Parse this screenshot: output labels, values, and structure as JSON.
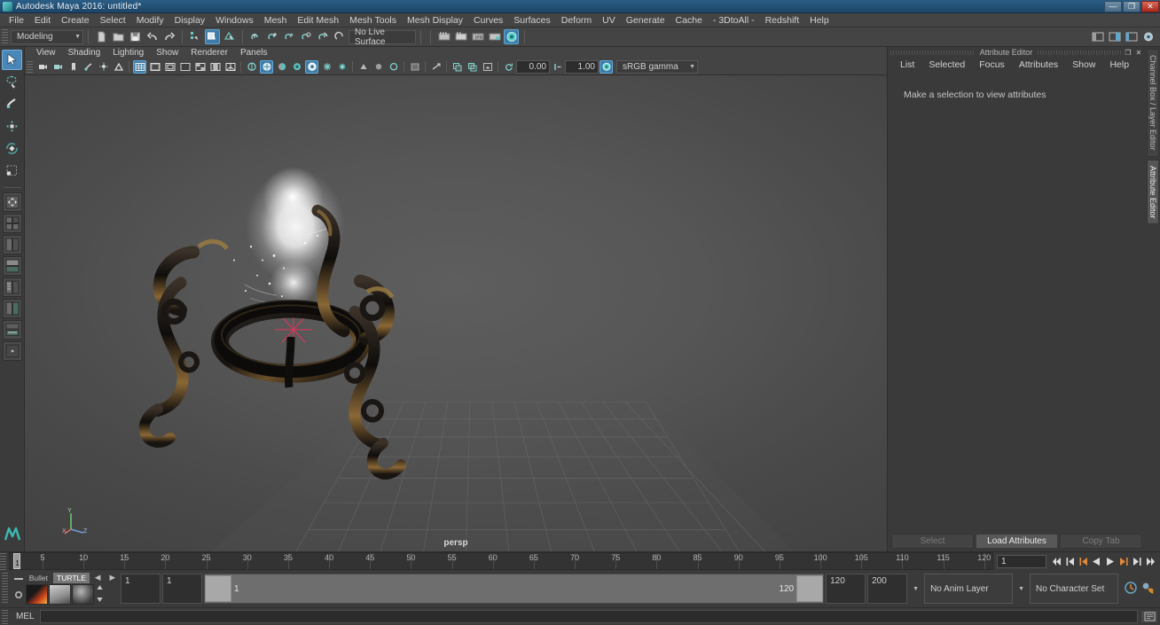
{
  "window": {
    "title": "Autodesk Maya 2016: untitled*",
    "app_icon": "maya-logo-icon",
    "buttons": [
      {
        "name": "minimize-button",
        "glyph": "—"
      },
      {
        "name": "restore-button",
        "glyph": "❐"
      },
      {
        "name": "close-button",
        "glyph": "✕"
      }
    ]
  },
  "menubar": {
    "items": [
      "File",
      "Edit",
      "Create",
      "Select",
      "Modify",
      "Display",
      "Windows",
      "Mesh",
      "Edit Mesh",
      "Mesh Tools",
      "Mesh Display",
      "Curves",
      "Surfaces",
      "Deform",
      "UV",
      "Generate",
      "Cache",
      "- 3DtoAll -",
      "Redshift",
      "Help"
    ]
  },
  "statusbar": {
    "menuset": "Modeling",
    "menuset_arrow": "▼",
    "file_icons": [
      "new-scene-icon",
      "open-scene-icon",
      "save-scene-icon",
      "undo-icon",
      "redo-icon"
    ],
    "select_mode_icons": [
      "select-by-hierarchy-icon",
      "select-by-object-icon",
      "select-by-component-icon"
    ],
    "snap_icons": [
      "snap-to-grid-icon",
      "snap-to-curve-icon",
      "snap-to-point-icon",
      "snap-to-projected-center-icon",
      "snap-to-view-plane-icon",
      "make-live-icon"
    ],
    "live_surface": "No Live Surface",
    "render_icons": [
      "render-current-frame-icon",
      "ipr-render-icon",
      "render-settings-icon",
      "hypershade-icon",
      "render-view-icon"
    ],
    "right_icons": [
      "show-hide-modeling-toolkit-icon",
      "show-hide-attribute-editor-icon",
      "show-hide-tool-settings-icon",
      "show-hide-channel-box-icon"
    ]
  },
  "toolbox": {
    "tools": [
      {
        "name": "select-tool",
        "icon": "arrow-cursor-icon",
        "active": true
      },
      {
        "name": "lasso-select-tool",
        "icon": "lasso-icon",
        "active": false
      },
      {
        "name": "paint-select-tool",
        "icon": "paintbrush-icon",
        "active": false
      },
      {
        "name": "move-tool",
        "icon": "move-arrows-icon",
        "active": false
      },
      {
        "name": "rotate-tool",
        "icon": "rotate-ring-icon",
        "active": false
      },
      {
        "name": "scale-tool",
        "icon": "scale-box-icon",
        "active": false
      }
    ],
    "layouts": [
      "layout-single-perspective",
      "layout-four-view",
      "layout-two-panes-side",
      "layout-two-panes-stacked",
      "layout-three-panes",
      "layout-persp-outliner",
      "layout-persp-graph",
      "layout-custom"
    ]
  },
  "viewport": {
    "panel_menu": [
      "View",
      "Shading",
      "Lighting",
      "Show",
      "Renderer",
      "Panels"
    ],
    "toolbar_icons": [
      "select-camera-icon",
      "camera-attributes-icon",
      "bookmark-icon",
      "image-plane-icon",
      "two-sided-lighting-icon",
      "grid-toggle-icon",
      "film-gate-icon",
      "resolution-gate-icon",
      "gate-mask-icon",
      "field-chart-icon",
      "safe-action-icon",
      "safe-title-icon",
      "wireframe-icon",
      "smooth-shade-all-icon",
      "shaded-wireframe-icon",
      "textured-icon",
      "use-all-lights-icon",
      "shadows-icon",
      "ao-icon",
      "motion-blur-icon",
      "multisample-icon",
      "depth-of-field-icon",
      "xray-mode-icon",
      "xray-joints-icon"
    ],
    "exposure_value": "0.00",
    "gamma_value": "1.00",
    "color_management": "sRGB gamma",
    "color_management_arrow": "▼",
    "camera_label": "persp",
    "axis_labels": {
      "y": "Y",
      "x": "X",
      "z": "Z"
    }
  },
  "attribute_editor": {
    "panel_title": "Attribute Editor",
    "window_buttons": [
      {
        "name": "undock-panel-button",
        "glyph": "❐"
      },
      {
        "name": "close-panel-button",
        "glyph": "✕"
      }
    ],
    "menu": [
      "List",
      "Selected",
      "Focus",
      "Attributes",
      "Show",
      "Help"
    ],
    "empty_message": "Make a selection to view attributes",
    "footer_buttons": [
      {
        "label": "Select",
        "enabled": false
      },
      {
        "label": "Load Attributes",
        "enabled": true
      },
      {
        "label": "Copy Tab",
        "enabled": false
      }
    ],
    "side_tabs": [
      {
        "label": "Channel Box / Layer Editor",
        "active": false
      },
      {
        "label": "Attribute Editor",
        "active": true
      }
    ]
  },
  "timeline": {
    "start": 1,
    "end": 120,
    "tick_labels": [
      5,
      10,
      15,
      20,
      25,
      30,
      35,
      40,
      45,
      50,
      55,
      60,
      65,
      70,
      75,
      80,
      85,
      90,
      95,
      100,
      105,
      110,
      115,
      120
    ],
    "current_frame": "1",
    "current_frame_marker": "1",
    "playback_buttons": [
      {
        "name": "go-to-start-button",
        "glyph": "⏮"
      },
      {
        "name": "step-back-keyframe-button",
        "glyph": "◀|"
      },
      {
        "name": "step-back-frame-button",
        "glyph": "◀"
      },
      {
        "name": "play-backwards-button",
        "glyph": "◀"
      },
      {
        "name": "play-forwards-button",
        "glyph": "▶"
      },
      {
        "name": "step-forward-frame-button",
        "glyph": "▶"
      },
      {
        "name": "step-forward-keyframe-button",
        "glyph": "|▶"
      },
      {
        "name": "go-to-end-button",
        "glyph": "⏭"
      }
    ]
  },
  "range_row": {
    "shelf_tabs": [
      {
        "label": "Bullet",
        "active": false
      },
      {
        "label": "TURTLE",
        "active": true
      }
    ],
    "shelf_nav": [
      "◀",
      "▶"
    ],
    "shelf_icons": [
      "turtle-bake-icon",
      "turtle-render-icon",
      "turtle-shader-icon"
    ],
    "anim_start": "1",
    "anim_end": "1",
    "range_start": "1",
    "range_end": "120",
    "playback_end": "120",
    "anim_total_end": "200",
    "anim_layer": "No Anim Layer",
    "character_set": "No Character Set",
    "trailing_icons": [
      "auto-keyframe-toggle-icon",
      "animation-preferences-icon"
    ]
  },
  "mel_bar": {
    "label": "MEL",
    "input_value": "",
    "input_placeholder": "",
    "script_editor_icon": "script-editor-icon"
  },
  "colors": {
    "accent_blue": "#4a86b8",
    "title_blue": "#2b5e86",
    "panel_gray": "#3a3a3a",
    "viewport_gray": "#565656",
    "close_red": "#a8281a",
    "teal_icon": "#4fb9b5"
  }
}
